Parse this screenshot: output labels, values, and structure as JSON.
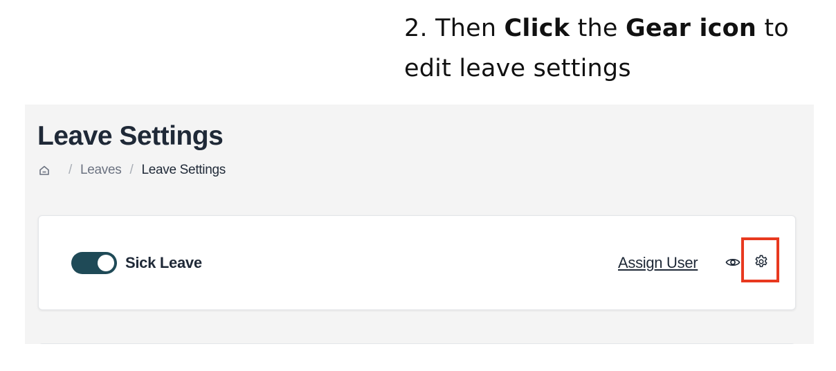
{
  "instruction": {
    "step": "2. Then",
    "action": "Click",
    "middle": "the",
    "target": "Gear icon",
    "rest": "to edit leave settings"
  },
  "page": {
    "title": "Leave Settings"
  },
  "breadcrumb": {
    "home_icon": "home-icon",
    "separator": "/",
    "items": [
      "Leaves",
      "Leave Settings"
    ]
  },
  "leave_card": {
    "enabled": true,
    "name": "Sick Leave",
    "assign_user_label": "Assign User",
    "view_icon": "eye-icon",
    "settings_icon": "gear-icon"
  },
  "colors": {
    "toggle_on": "#1f4a57",
    "highlight": "#e8391f",
    "panel_bg": "#f4f4f4",
    "text_dark": "#1f2937",
    "text_muted": "#6b7280"
  }
}
